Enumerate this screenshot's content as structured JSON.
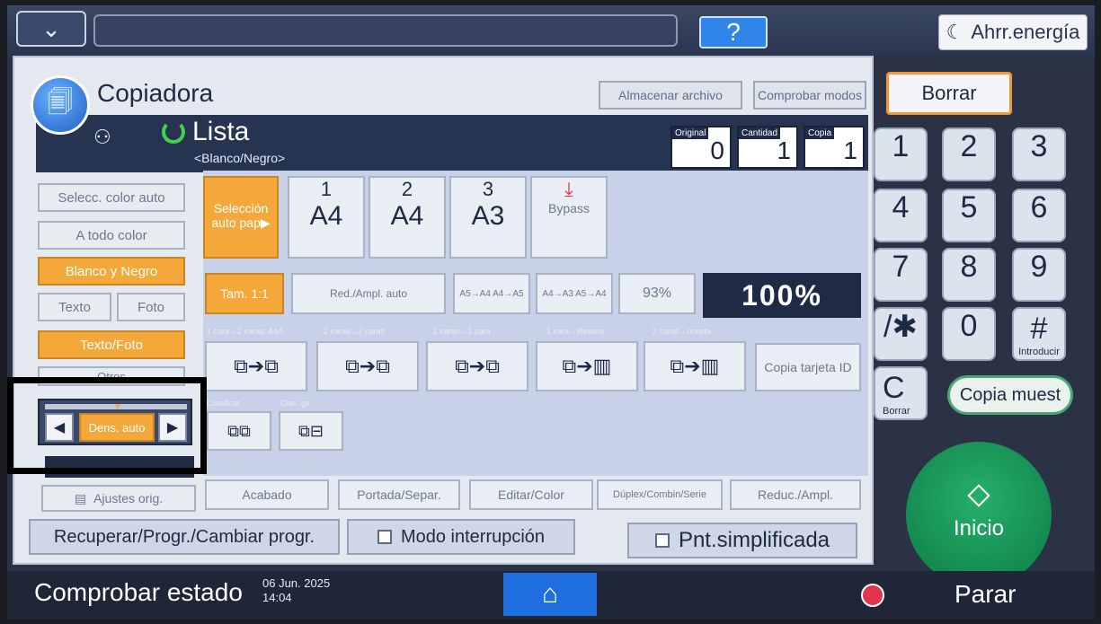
{
  "topbar": {
    "help_label": "?",
    "energy_label": "Ahrr.energía"
  },
  "app": {
    "title": "Copiadora",
    "store_file": "Almacenar archivo",
    "check_modes": "Comprobar modos",
    "status": "Lista",
    "color_mode": "<Blanco/Negro>"
  },
  "counters": [
    {
      "label": "Original",
      "value": "0"
    },
    {
      "label": "Cantidad",
      "value": "1"
    },
    {
      "label": "Copia",
      "value": "1"
    }
  ],
  "left": {
    "auto_color": "Selecc. color auto",
    "full_color": "A todo color",
    "bw": "Blanco y Negro",
    "text": "Texto",
    "photo": "Foto",
    "text_photo": "Texto/Foto",
    "others": "Otros",
    "density_auto": "Dens. auto",
    "orig_settings": "Ajustes orig."
  },
  "paper": {
    "auto": "Selección auto pap▶",
    "trays": [
      {
        "num": "1",
        "size": "A4"
      },
      {
        "num": "2",
        "size": "A4"
      },
      {
        "num": "3",
        "size": "A3"
      }
    ],
    "bypass": "Bypass"
  },
  "zoom": {
    "full": "Tam. 1:1",
    "auto": "Red./Ampl. auto",
    "a5a4": "A5→A4 A4→A5",
    "a4a3": "A4→A3 A5→A4",
    "pct": "93%",
    "value": "100%"
  },
  "duplex": {
    "labels": [
      "1 cara→2 caras: AaA",
      "2 caras→2 caras",
      "2 caras→1 cara",
      "1 cara→Revista",
      "2 caras→revista"
    ],
    "id_card": "Copia tarjeta ID",
    "sort_label": "Clasificar",
    "stack_label": "Clas. gir."
  },
  "tabs": [
    "Acabado",
    "Portada/Separ.",
    "Editar/Color",
    "Dúplex/Combin/Serie",
    "Reduc./Ampl."
  ],
  "row": {
    "recall": "Recuperar/Progr./Cambiar progr.",
    "interrupt": "Modo interrupción",
    "simple": "Pnt.simplificada"
  },
  "keypad": {
    "clear": "Borrar",
    "keys": [
      "1",
      "2",
      "3",
      "4",
      "5",
      "6",
      "7",
      "8",
      "9",
      "/✱",
      "0",
      "#"
    ],
    "enter": "Introducir",
    "c_key": "C",
    "c_sub": "Borrar",
    "sample": "Copia muest",
    "start": "Inicio"
  },
  "footer": {
    "status": "Comprobar estado",
    "date": "06 Jun. 2025",
    "time": "14:04",
    "stop": "Parar"
  }
}
